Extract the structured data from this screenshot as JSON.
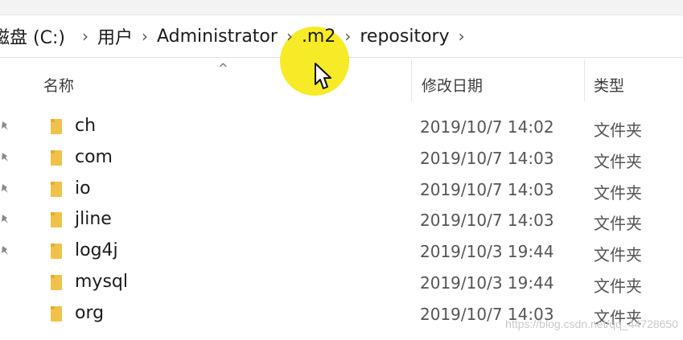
{
  "breadcrumb": {
    "items": [
      "磁盘 (C:)",
      "用户",
      "Administrator",
      ".m2",
      "repository"
    ]
  },
  "columns": {
    "name": "名称",
    "date": "修改日期",
    "type": "类型",
    "sort_indicator": "^"
  },
  "files": [
    {
      "name": "ch",
      "date": "2019/10/7 14:02",
      "type": "文件夹"
    },
    {
      "name": "com",
      "date": "2019/10/7 14:03",
      "type": "文件夹"
    },
    {
      "name": "io",
      "date": "2019/10/7 14:03",
      "type": "文件夹"
    },
    {
      "name": "jline",
      "date": "2019/10/7 14:03",
      "type": "文件夹"
    },
    {
      "name": "log4j",
      "date": "2019/10/3 19:44",
      "type": "文件夹"
    },
    {
      "name": "mysql",
      "date": "2019/10/3 19:44",
      "type": "文件夹"
    },
    {
      "name": "org",
      "date": "2019/10/7 14:03",
      "type": "文件夹"
    }
  ],
  "watermark": "https://blog.csdn.net/qq_44728650",
  "colors": {
    "highlight": "#f6ea1a",
    "folder": "#f0c24a"
  },
  "icons": {
    "folder": "folder-icon",
    "pin": "pin-icon",
    "chevron": "chevron-right-icon",
    "cursor": "mouse-cursor-icon"
  }
}
